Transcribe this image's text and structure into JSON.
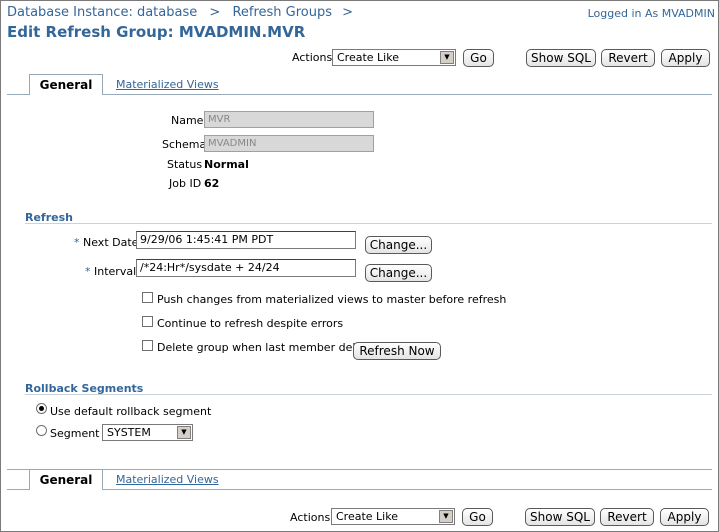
{
  "header": {
    "breadcrumb": [
      "Database Instance: database",
      ">",
      "Refresh Groups",
      ">"
    ],
    "login_text": "Logged in As MVADMIN",
    "title": "Edit Refresh Group: MVADMIN.MVR"
  },
  "toolbar": {
    "actions_label": "Actions",
    "actions_value": "Create Like",
    "go_label": "Go",
    "show_sql_label": "Show SQL",
    "revert_label": "Revert",
    "apply_label": "Apply"
  },
  "tabs": [
    {
      "label": "General",
      "active": true
    },
    {
      "label": "Materialized Views",
      "active": false
    }
  ],
  "general": {
    "name_label": "Name",
    "name_value": "MVR",
    "schema_label": "Schema",
    "schema_value": "MVADMIN",
    "status_label": "Status",
    "status_value": "Normal",
    "jobid_label": "Job ID",
    "jobid_value": "62"
  },
  "refresh": {
    "section_title": "Refresh",
    "required_marker": "*",
    "next_date_label": "Next Date",
    "next_date_value": "9/29/06 1:45:41 PM PDT",
    "interval_label": "Interval",
    "interval_value": "/*24:Hr*/sysdate + 24/24",
    "change_label": "Change...",
    "push_label": "Push changes from materialized views to master before refresh",
    "continue_label": "Continue to refresh despite errors",
    "delete_label": "Delete group when last member deleted",
    "refresh_now_label": "Refresh Now"
  },
  "rollback": {
    "section_title": "Rollback Segments",
    "default_label": "Use default rollback segment",
    "segment_label": "Segment",
    "segment_value": "SYSTEM",
    "selected": "default"
  },
  "colors": {
    "accent": "#336699",
    "readonly_bg": "#d8d8d8"
  }
}
